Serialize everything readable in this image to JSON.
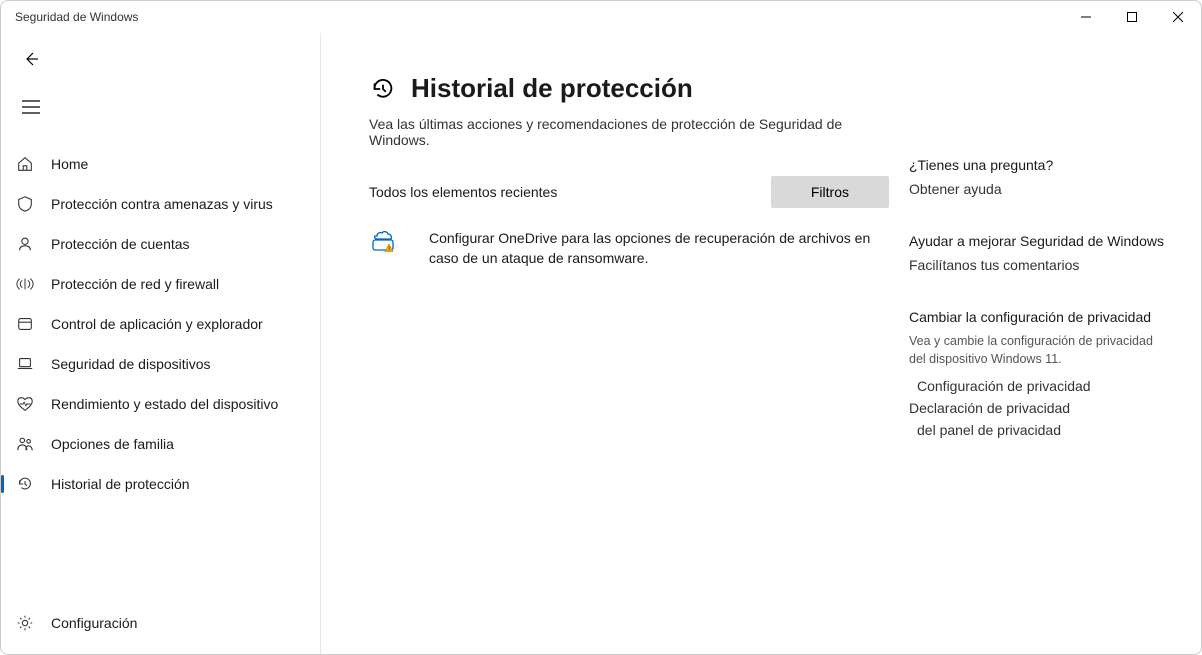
{
  "window": {
    "title": "Seguridad de Windows"
  },
  "sidebar": {
    "items": [
      {
        "label": "Home",
        "icon": "home"
      },
      {
        "label": "Protección contra amenazas y virus",
        "icon": "shield"
      },
      {
        "label": "Protección de cuentas",
        "icon": "person"
      },
      {
        "label": "Protección de red y firewall",
        "icon": "wifi"
      },
      {
        "label": "Control de aplicación y explorador",
        "icon": "app"
      },
      {
        "label": "Seguridad de dispositivos",
        "icon": "laptop"
      },
      {
        "label": "Rendimiento y estado del dispositivo",
        "icon": "heart"
      },
      {
        "label": "Opciones de familia",
        "icon": "family"
      },
      {
        "label": "Historial de protección",
        "icon": "history",
        "selected": true
      }
    ],
    "settings": {
      "label": "Configuración",
      "icon": "gear"
    }
  },
  "page": {
    "title": "Historial de protección",
    "description": "Vea las últimas acciones y recomendaciones de protección de Seguridad de Windows.",
    "recent_label": "Todos los elementos recientes",
    "filters_label": "Filtros",
    "history_item": "Configurar OneDrive para las opciones de recuperación de archivos en caso de un ataque de ransomware."
  },
  "aside": {
    "question": {
      "heading": "¿Tienes una pregunta?",
      "link": "Obtener ayuda"
    },
    "improve": {
      "heading": "Ayudar a mejorar Seguridad de Windows",
      "link": "Facilítanos tus comentarios"
    },
    "privacy": {
      "heading": "Cambiar la configuración de privacidad",
      "desc": "Vea y cambie la configuración de privacidad del dispositivo Windows 11.",
      "link1": "Configuración de privacidad",
      "link2": "Declaración de privacidad",
      "link3": "del panel de privacidad"
    }
  }
}
